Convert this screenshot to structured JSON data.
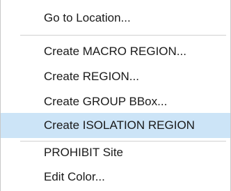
{
  "context_menu": {
    "items": [
      {
        "label": "Go to Location...",
        "highlighted": false
      },
      {
        "label": "Create MACRO REGION...",
        "highlighted": false
      },
      {
        "label": "Create REGION...",
        "highlighted": false
      },
      {
        "label": "Create GROUP BBox...",
        "highlighted": false
      },
      {
        "label": "Create ISOLATION REGION",
        "highlighted": true
      },
      {
        "label": "PROHIBIT Site",
        "highlighted": false
      },
      {
        "label": "Edit Color...",
        "highlighted": false
      }
    ],
    "highlight_color": "#cce4f7",
    "separator_color": "#d0d0d0"
  }
}
